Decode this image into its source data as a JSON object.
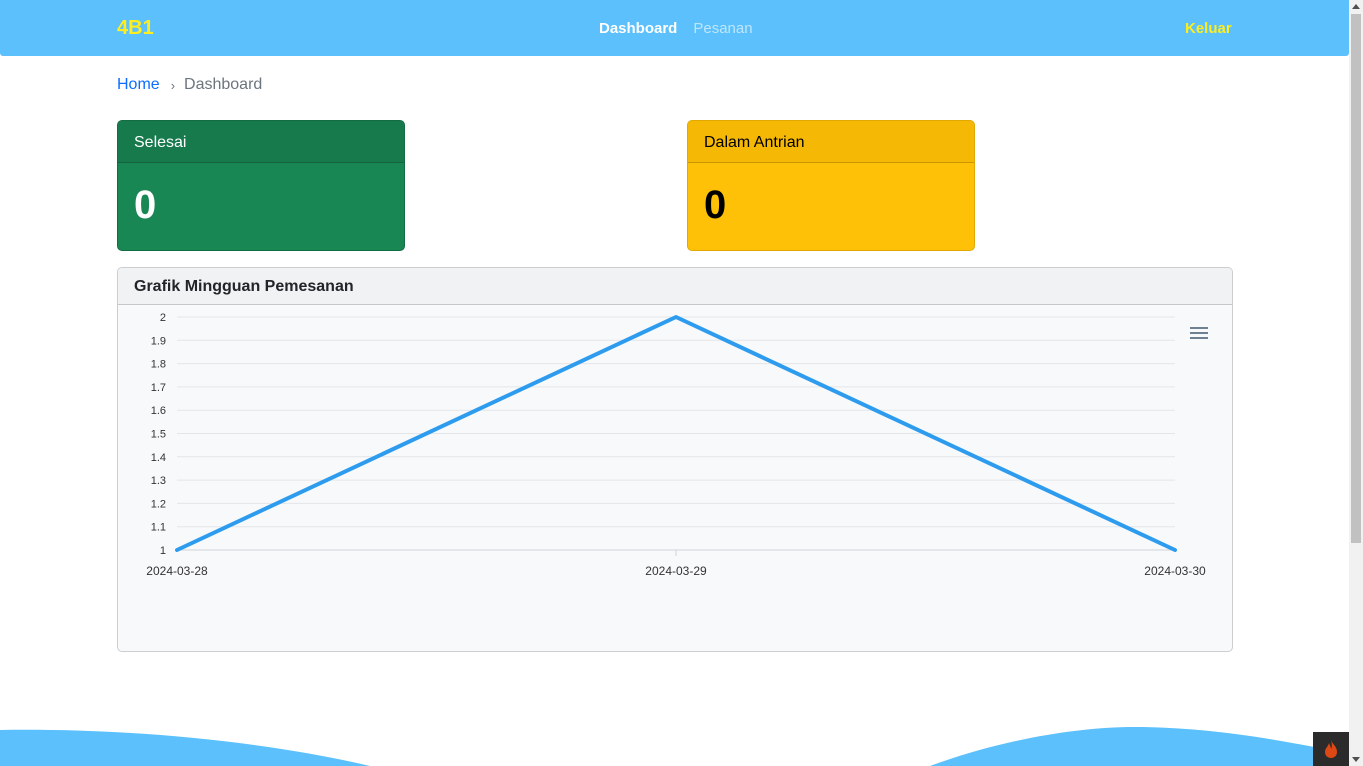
{
  "navbar": {
    "brand": "4B1",
    "links": [
      {
        "label": "Dashboard",
        "active": true
      },
      {
        "label": "Pesanan",
        "active": false
      }
    ],
    "logout": "Keluar",
    "bg_color": "#5bc0fb",
    "accent_color": "#ffee1f"
  },
  "breadcrumb": {
    "home": "Home",
    "separator": "›",
    "current": "Dashboard"
  },
  "stats": {
    "done": {
      "label": "Selesai",
      "value": "0",
      "color": "#198754"
    },
    "queue": {
      "label": "Dalam Antrian",
      "value": "0",
      "color": "#ffc107"
    }
  },
  "chart_card": {
    "title": "Grafik Mingguan Pemesanan",
    "menu_icon": "hamburger-menu-icon"
  },
  "chart_data": {
    "type": "line",
    "categories": [
      "2024-03-28",
      "2024-03-29",
      "2024-03-30"
    ],
    "series": [
      {
        "values": [
          1,
          2,
          1
        ],
        "color": "#2e9cee"
      }
    ],
    "ylim": [
      1,
      2
    ],
    "yticks": [
      "1",
      "1.1",
      "1.2",
      "1.3",
      "1.4",
      "1.5",
      "1.6",
      "1.7",
      "1.8",
      "1.9",
      "2"
    ],
    "grid": true
  }
}
